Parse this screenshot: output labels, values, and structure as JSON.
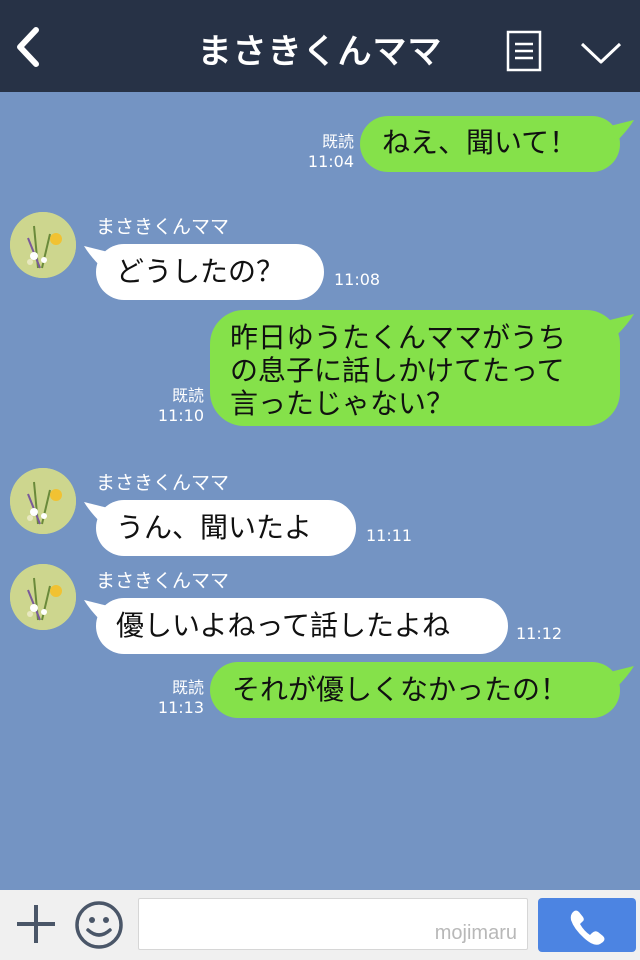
{
  "header": {
    "title": "まさきくんママ",
    "icons": [
      "chevron-left-icon",
      "menu-list-icon",
      "chevron-down-icon"
    ]
  },
  "messages": [
    {
      "side": "me",
      "text": "ねえ、聞いて！",
      "read": "既読",
      "time": "11:04"
    },
    {
      "side": "them",
      "sender": "まさきくんママ",
      "text": "どうしたの？",
      "time": "11:08"
    },
    {
      "side": "me",
      "lines": [
        "昨日ゆうたくんママがうち",
        "の息子に話しかけてたって",
        "言ったじゃない？"
      ],
      "read": "既読",
      "time": "11:10"
    },
    {
      "side": "them",
      "sender": "まさきくんママ",
      "text": "うん、聞いたよ",
      "time": "11:11"
    },
    {
      "side": "them",
      "sender": "まさきくんママ",
      "text": "優しいよねって話したよね",
      "time": "11:12"
    },
    {
      "side": "me",
      "text": "それが優しくなかったの！",
      "read": "既読",
      "time": "11:13"
    }
  ],
  "input": {
    "value": "",
    "watermark": "mojimaru",
    "icons": [
      "plus-icon",
      "smiley-icon",
      "phone-icon"
    ]
  },
  "colors": {
    "header": "#273246",
    "chat_background": "#7494c3",
    "my_bubble": "#85e14a",
    "their_bubble": "#ffffff",
    "call_button": "#4c84e2"
  }
}
